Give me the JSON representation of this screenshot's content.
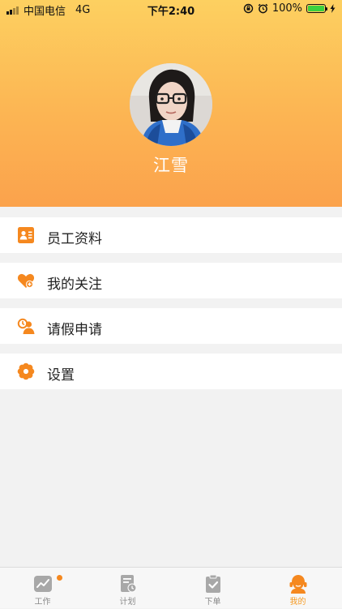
{
  "status_bar": {
    "carrier": "中国电信",
    "network": "4G",
    "time": "下午2:40",
    "battery": "100%"
  },
  "profile": {
    "name": "江雪"
  },
  "menu": [
    {
      "label": "员工资料",
      "icon": "contact-card-icon"
    },
    {
      "label": "我的关注",
      "icon": "heart-plus-icon"
    },
    {
      "label": "请假申请",
      "icon": "leave-request-icon"
    },
    {
      "label": "设置",
      "icon": "settings-flower-icon"
    }
  ],
  "tabs": [
    {
      "label": "工作",
      "icon": "trend-chart-icon",
      "badge": true
    },
    {
      "label": "计划",
      "icon": "plan-calendar-icon"
    },
    {
      "label": "下单",
      "icon": "order-check-icon"
    },
    {
      "label": "我的",
      "icon": "profile-icon",
      "active": true
    }
  ],
  "colors": {
    "accent": "#f5881f",
    "header_top": "#fdd060",
    "header_bottom": "#fba24c"
  }
}
